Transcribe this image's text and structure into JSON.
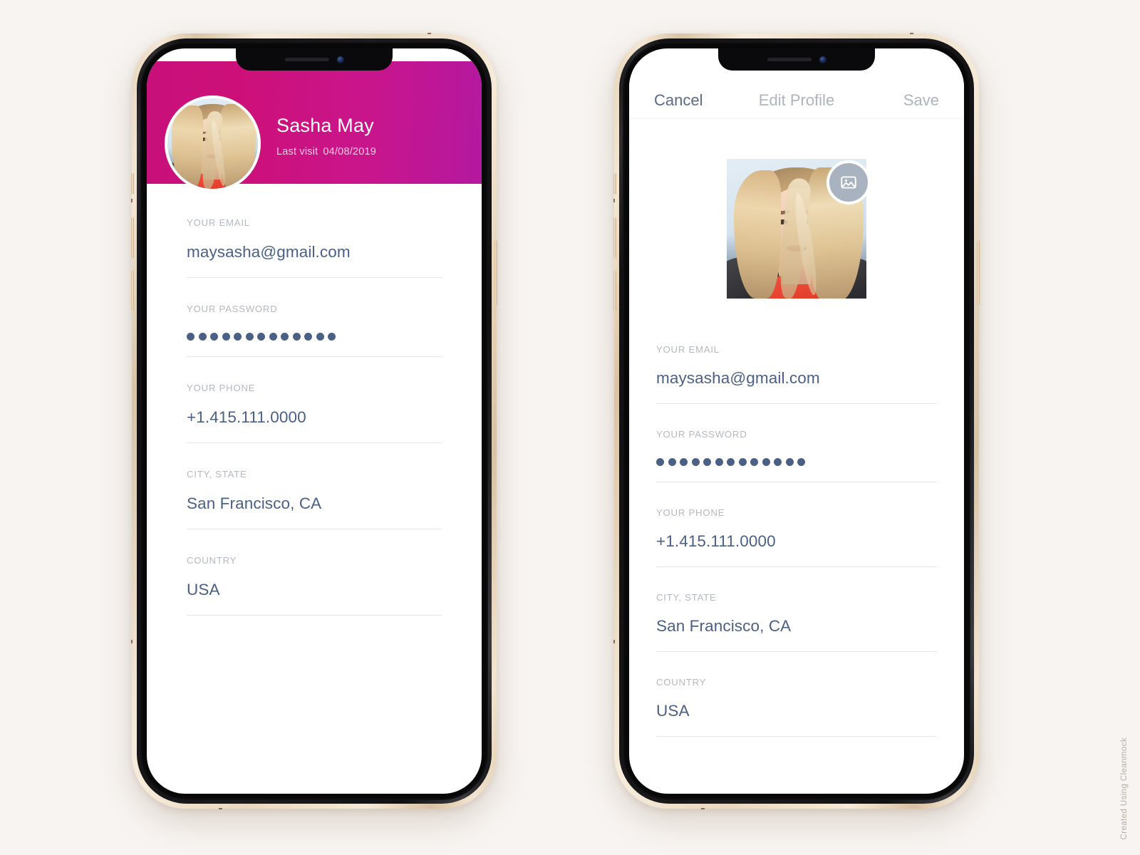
{
  "background_color": "#f8f4f1",
  "brand": {
    "gradient_start": "#c8107a",
    "gradient_end": "#b4189f",
    "value_color": "#4b6085",
    "label_color": "#b4b9c1"
  },
  "watermark": "Created Using Cleanmock",
  "profile_screen": {
    "name": "Sasha May",
    "last_visit_label": "Last visit",
    "last_visit_date": "04/08/2019",
    "avatar_alt": "Sasha May profile photo",
    "fields": [
      {
        "label": "YOUR EMAIL",
        "value": "maysasha@gmail.com",
        "type": "text"
      },
      {
        "label": "YOUR PASSWORD",
        "value": "•••••••••••••",
        "type": "password",
        "dot_count": 13
      },
      {
        "label": "YOUR PHONE",
        "value": "+1.415.111.0000",
        "type": "text"
      },
      {
        "label": "CITY, STATE",
        "value": "San Francisco, CA",
        "type": "text"
      },
      {
        "label": "COUNTRY",
        "value": "USA",
        "type": "text"
      }
    ]
  },
  "edit_screen": {
    "nav": {
      "cancel_label": "Cancel",
      "title": "Edit Profile",
      "save_label": "Save"
    },
    "avatar_alt": "Sasha May profile photo",
    "change_photo_icon": "image-icon",
    "fields": [
      {
        "label": "YOUR EMAIL",
        "value": "maysasha@gmail.com",
        "type": "text"
      },
      {
        "label": "YOUR PASSWORD",
        "value": "•••••••••••••",
        "type": "password",
        "dot_count": 13
      },
      {
        "label": "YOUR PHONE",
        "value": "+1.415.111.0000",
        "type": "text"
      },
      {
        "label": "CITY, STATE",
        "value": "San Francisco, CA",
        "type": "text"
      },
      {
        "label": "COUNTRY",
        "value": "USA",
        "type": "text"
      }
    ]
  }
}
